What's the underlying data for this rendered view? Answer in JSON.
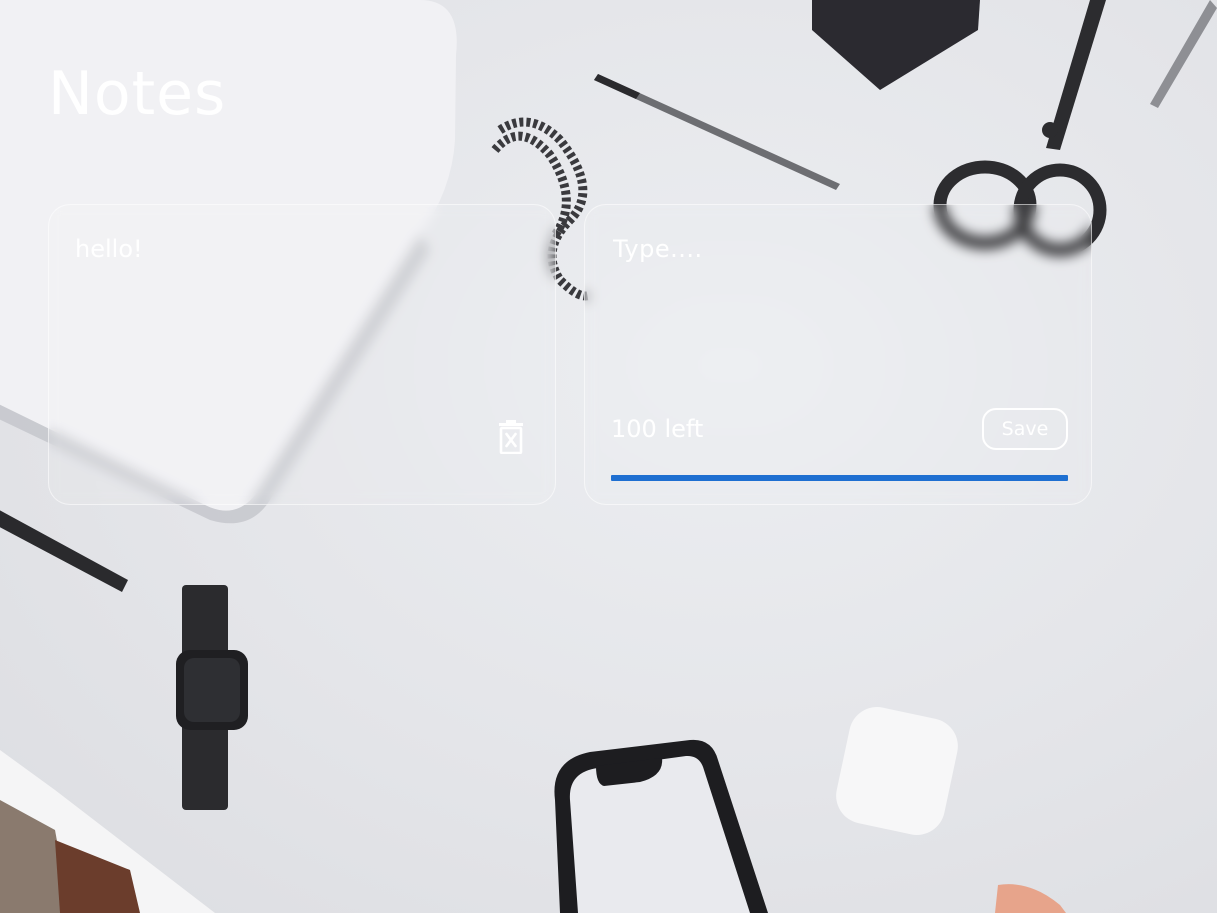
{
  "page": {
    "title": "Notes"
  },
  "notes": [
    {
      "text": "hello!",
      "delete_icon": "trash-x-icon"
    }
  ],
  "new_note": {
    "placeholder": "Type....",
    "value": "",
    "chars_left": "100 left",
    "save_label": "Save",
    "progress_fraction": 1.0,
    "progress_color": "#1e6fd1"
  },
  "colors": {
    "text": "#ffffff",
    "card_border": "rgba(255,255,255,0.55)"
  }
}
